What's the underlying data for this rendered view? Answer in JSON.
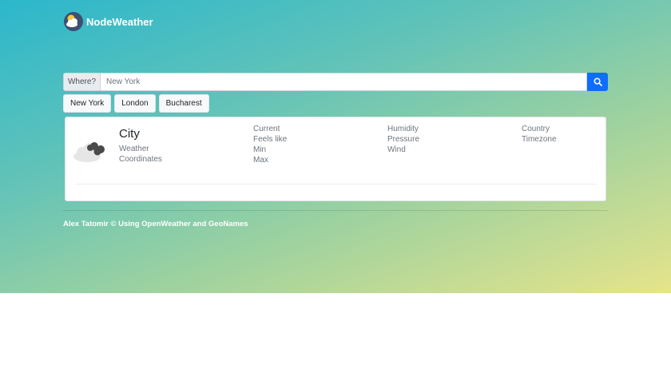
{
  "brand": {
    "name": "NodeWeather",
    "logo_icon": "cloud-sun-icon"
  },
  "search": {
    "label": "Where?",
    "placeholder": "New York",
    "button_icon": "search-icon"
  },
  "quick_cities": [
    "New York",
    "London",
    "Bucharest"
  ],
  "weather_card": {
    "icon": "cloud-icon",
    "city": "City",
    "left_lines": [
      "Weather",
      "Coordinates"
    ],
    "column_a": [
      "Current",
      "Feels like",
      "Min",
      "Max"
    ],
    "column_b": [
      "Humidity",
      "Pressure",
      "Wind"
    ],
    "column_c": [
      "Country",
      "Timezone"
    ]
  },
  "footer": {
    "text": "Alex Tatomir © Using OpenWeather and GeoNames"
  },
  "colors": {
    "gradient_start": "#2bb7cc",
    "gradient_end": "#e6e48a",
    "primary": "#0d6efd",
    "logo_bg": "#3d4f72"
  }
}
